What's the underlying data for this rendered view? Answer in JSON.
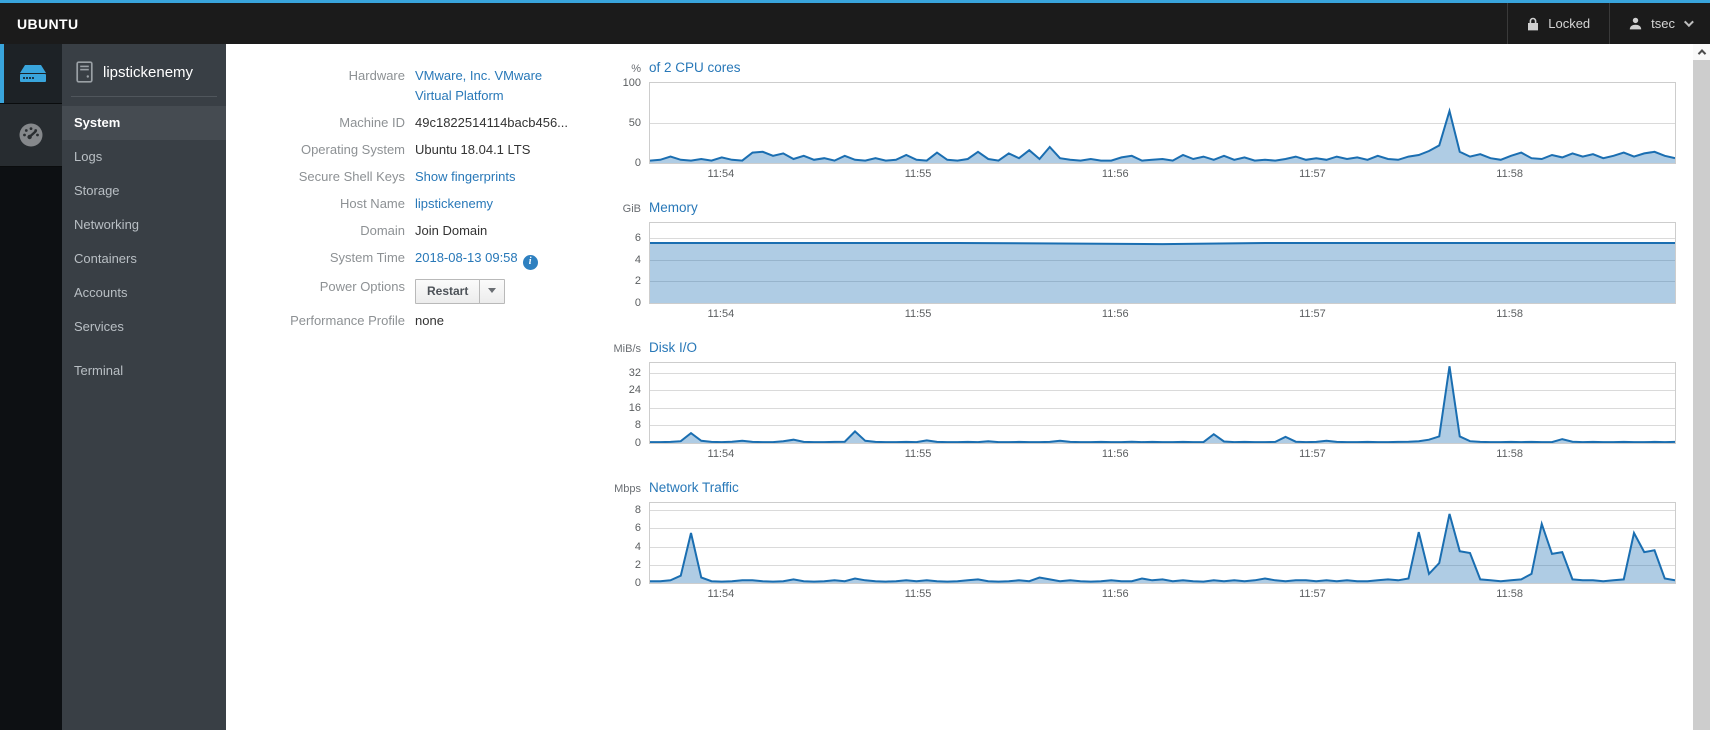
{
  "topnav": {
    "brand": "UBUNTU",
    "locked_label": "Locked",
    "user": "tsec"
  },
  "rail": {
    "items": [
      {
        "name": "machines",
        "active": true
      },
      {
        "name": "dashboard",
        "active": false
      }
    ]
  },
  "sidebar": {
    "hostname": "lipstickenemy",
    "items": [
      {
        "label": "System",
        "active": true
      },
      {
        "label": "Logs"
      },
      {
        "label": "Storage"
      },
      {
        "label": "Networking"
      },
      {
        "label": "Containers"
      },
      {
        "label": "Accounts"
      },
      {
        "label": "Services"
      },
      {
        "label": "Terminal",
        "separated": true
      }
    ]
  },
  "system_info": {
    "rows": [
      {
        "id": "hardware",
        "label": "Hardware",
        "value": "VMware, Inc. VMware Virtual Platform",
        "type": "link",
        "wrap": true
      },
      {
        "id": "machine-id",
        "label": "Machine ID",
        "value": "49c1822514114bacb456...",
        "type": "text"
      },
      {
        "id": "operating-system",
        "label": "Operating System",
        "value": "Ubuntu 18.04.1 LTS",
        "type": "text"
      },
      {
        "id": "secure-shell-keys",
        "label": "Secure Shell Keys",
        "value": "Show fingerprints",
        "type": "link"
      },
      {
        "id": "host-name",
        "label": "Host Name",
        "value": "lipstickenemy",
        "type": "link"
      },
      {
        "id": "domain",
        "label": "Domain",
        "value": "Join Domain",
        "type": "text"
      },
      {
        "id": "system-time",
        "label": "System Time",
        "value": "2018-08-13 09:58",
        "type": "link",
        "info_icon": true
      },
      {
        "id": "power-options",
        "label": "Power Options",
        "value": "Restart",
        "type": "button"
      },
      {
        "id": "performance-profile",
        "label": "Performance Profile",
        "value": "none",
        "type": "text"
      }
    ]
  },
  "icons": [
    "server-machines-icon",
    "dashboard-gauge-icon",
    "host-server-icon",
    "lock-icon",
    "user-icon",
    "chevron-down-icon",
    "chevron-up-icon",
    "info-icon",
    "caret-down-icon"
  ],
  "colors": {
    "accent": "#39a5dc",
    "link": "#2878b8",
    "navbar_bg": "#1b1b1b",
    "sidebar_bg": "#393f45",
    "chart_line": "#1a6eb1",
    "chart_fill": "rgba(26,110,177,0.35)",
    "grid": "#dadada"
  },
  "chart_data": [
    {
      "id": "cpu",
      "type": "area",
      "unit": "%",
      "title": "of 2 CPU cores",
      "ylim": [
        0,
        100
      ],
      "yticks": [
        0,
        50,
        100
      ],
      "grid": true,
      "legend": "none",
      "x_ticks": [
        {
          "label": "11:54",
          "pos": 7
        },
        {
          "label": "11:55",
          "pos": 26.2
        },
        {
          "label": "11:56",
          "pos": 45.4
        },
        {
          "label": "11:57",
          "pos": 64.6
        },
        {
          "label": "11:58",
          "pos": 83.8
        }
      ],
      "values": [
        3,
        4,
        8,
        4,
        3,
        5,
        3,
        7,
        4,
        3,
        13,
        14,
        9,
        12,
        5,
        9,
        4,
        6,
        3,
        9,
        4,
        3,
        6,
        3,
        4,
        10,
        4,
        3,
        13,
        4,
        3,
        5,
        14,
        5,
        3,
        12,
        6,
        16,
        5,
        20,
        6,
        4,
        3,
        5,
        3,
        3,
        7,
        9,
        3,
        4,
        5,
        3,
        10,
        5,
        8,
        4,
        9,
        4,
        7,
        3,
        4,
        3,
        5,
        8,
        4,
        6,
        4,
        8,
        5,
        7,
        4,
        9,
        5,
        4,
        8,
        10,
        15,
        22,
        65,
        14,
        8,
        11,
        6,
        4,
        9,
        13,
        6,
        5,
        10,
        7,
        12,
        8,
        11,
        6,
        9,
        13,
        8,
        12,
        14,
        9,
        6
      ]
    },
    {
      "id": "memory",
      "type": "area",
      "unit": "GiB",
      "title": "Memory",
      "ylim": [
        0,
        7.4
      ],
      "yticks": [
        0,
        2,
        4,
        6
      ],
      "grid": true,
      "legend": "none",
      "x_ticks": [
        {
          "label": "11:54",
          "pos": 7
        },
        {
          "label": "11:55",
          "pos": 26.2
        },
        {
          "label": "11:56",
          "pos": 45.4
        },
        {
          "label": "11:57",
          "pos": 64.6
        },
        {
          "label": "11:58",
          "pos": 83.8
        }
      ],
      "values": [
        5.55,
        5.55,
        5.55,
        5.55,
        5.5,
        5.45,
        5.55,
        5.55,
        5.55,
        5.55,
        5.55
      ]
    },
    {
      "id": "disk-io",
      "type": "area",
      "unit": "MiB/s",
      "title": "Disk I/O",
      "ylim": [
        0,
        36.5
      ],
      "yticks": [
        0,
        8,
        16,
        24,
        32
      ],
      "grid": true,
      "legend": "none",
      "x_ticks": [
        {
          "label": "11:54",
          "pos": 7
        },
        {
          "label": "11:55",
          "pos": 26.2
        },
        {
          "label": "11:56",
          "pos": 45.4
        },
        {
          "label": "11:57",
          "pos": 64.6
        },
        {
          "label": "11:58",
          "pos": 83.8
        }
      ],
      "values": [
        0.4,
        0.4,
        0.5,
        0.8,
        4.5,
        1.0,
        0.5,
        0.4,
        0.6,
        1.0,
        0.5,
        0.4,
        0.4,
        0.8,
        1.5,
        0.5,
        0.4,
        0.4,
        0.5,
        0.6,
        5.3,
        1.0,
        0.5,
        0.4,
        0.4,
        0.5,
        0.4,
        1.2,
        0.5,
        0.4,
        0.4,
        0.5,
        0.4,
        0.8,
        0.4,
        0.4,
        0.5,
        0.4,
        0.4,
        0.5,
        1.0,
        0.5,
        0.4,
        0.4,
        0.5,
        0.4,
        0.4,
        0.6,
        0.4,
        0.5,
        0.4,
        0.4,
        0.5,
        0.4,
        0.4,
        4.0,
        0.7,
        0.4,
        0.5,
        0.4,
        0.4,
        0.5,
        2.8,
        0.6,
        0.4,
        0.5,
        1.0,
        0.5,
        0.4,
        0.4,
        0.5,
        0.4,
        0.4,
        0.5,
        0.6,
        0.8,
        1.5,
        3.0,
        35,
        3.0,
        0.8,
        0.5,
        0.4,
        0.4,
        0.5,
        0.4,
        0.5,
        0.4,
        0.4,
        1.8,
        0.6,
        0.4,
        0.5,
        0.4,
        0.4,
        0.5,
        0.4,
        0.4,
        0.5,
        0.4,
        0.5
      ]
    },
    {
      "id": "network",
      "type": "area",
      "unit": "Mbps",
      "title": "Network Traffic",
      "ylim": [
        0,
        8.8
      ],
      "yticks": [
        0,
        2,
        4,
        6,
        8
      ],
      "grid": true,
      "legend": "none",
      "x_ticks": [
        {
          "label": "11:54",
          "pos": 7
        },
        {
          "label": "11:55",
          "pos": 26.2
        },
        {
          "label": "11:56",
          "pos": 45.4
        },
        {
          "label": "11:57",
          "pos": 64.6
        },
        {
          "label": "11:58",
          "pos": 83.8
        }
      ],
      "values": [
        0.2,
        0.2,
        0.3,
        0.8,
        5.5,
        0.6,
        0.2,
        0.15,
        0.2,
        0.3,
        0.3,
        0.2,
        0.15,
        0.2,
        0.4,
        0.2,
        0.15,
        0.2,
        0.3,
        0.2,
        0.5,
        0.3,
        0.2,
        0.15,
        0.2,
        0.3,
        0.2,
        0.3,
        0.2,
        0.15,
        0.2,
        0.3,
        0.4,
        0.2,
        0.15,
        0.2,
        0.3,
        0.2,
        0.6,
        0.4,
        0.2,
        0.3,
        0.2,
        0.15,
        0.2,
        0.3,
        0.2,
        0.2,
        0.5,
        0.3,
        0.4,
        0.2,
        0.3,
        0.2,
        0.15,
        0.3,
        0.2,
        0.3,
        0.2,
        0.3,
        0.5,
        0.3,
        0.2,
        0.3,
        0.3,
        0.2,
        0.3,
        0.2,
        0.3,
        0.2,
        0.2,
        0.3,
        0.4,
        0.3,
        0.5,
        5.6,
        1.0,
        2.2,
        7.6,
        3.5,
        3.3,
        0.4,
        0.3,
        0.2,
        0.3,
        0.4,
        1.0,
        6.5,
        3.2,
        3.4,
        0.4,
        0.3,
        0.3,
        0.2,
        0.3,
        0.4,
        5.5,
        3.4,
        3.6,
        0.5,
        0.3
      ]
    }
  ]
}
